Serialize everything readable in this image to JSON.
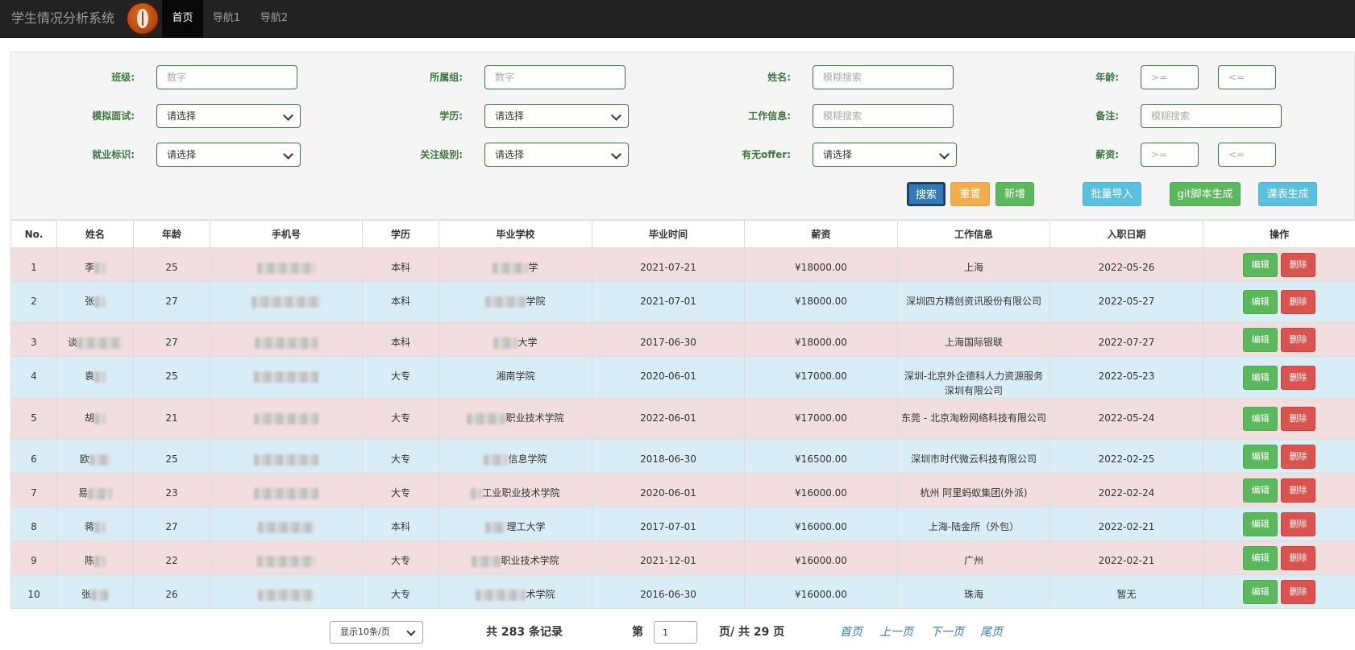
{
  "app": {
    "title": "学生情况分析系统",
    "nav": [
      "首页",
      "导航1",
      "导航2"
    ]
  },
  "filters": {
    "class_label": "班级:",
    "class_placeholder": "数字",
    "group_label": "所属组:",
    "group_placeholder": "数字",
    "name_label": "姓名:",
    "name_placeholder": "模糊搜索",
    "age_label": "年龄:",
    "age_min_placeholder": ">=",
    "age_max_placeholder": "<=",
    "mock_label": "模拟面试:",
    "mock_value": "请选择",
    "edu_label": "学历:",
    "edu_value": "请选择",
    "work_label": "工作信息:",
    "work_placeholder": "模糊搜索",
    "remark_label": "备注:",
    "remark_placeholder": "模糊搜索",
    "employ_label": "就业标识:",
    "employ_value": "请选择",
    "focus_label": "关注级别:",
    "focus_value": "请选择",
    "offer_label": "有无offer:",
    "offer_value": "请选择",
    "salary_label": "薪资:",
    "salary_min_placeholder": ">=",
    "salary_max_placeholder": "<="
  },
  "actions": {
    "search": "搜索",
    "reset": "重置",
    "add": "新增",
    "import": "批量导入",
    "git": "git脚本生成",
    "table_gen": "课表生成"
  },
  "table": {
    "headers": [
      "No.",
      "姓名",
      "年龄",
      "手机号",
      "学历",
      "毕业学校",
      "毕业时间",
      "薪资",
      "工作信息",
      "入职日期",
      "操作"
    ],
    "edit_label": "编辑",
    "delete_label": "删除",
    "rows": [
      {
        "no": "1",
        "name": "李",
        "age": "25",
        "edu": "本科",
        "school": "学",
        "grad": "2021-07-21",
        "salary": "¥18000.00",
        "work": "上海",
        "hire": "2022-05-26"
      },
      {
        "no": "2",
        "name": "张",
        "age": "27",
        "edu": "本科",
        "school": "学院",
        "grad": "2021-07-01",
        "salary": "¥18000.00",
        "work": "深圳四方精创资讯股份有限公司",
        "hire": "2022-05-27"
      },
      {
        "no": "3",
        "name": "谈",
        "age": "27",
        "edu": "本科",
        "school": "大学",
        "grad": "2017-06-30",
        "salary": "¥18000.00",
        "work": "上海国际银联",
        "hire": "2022-07-27"
      },
      {
        "no": "4",
        "name": "袁",
        "age": "25",
        "edu": "大专",
        "school": "湘南学院",
        "grad": "2020-06-01",
        "salary": "¥17000.00",
        "work": "深圳-北京外企德科人力资源服务深圳有限公司",
        "hire": "2022-05-23"
      },
      {
        "no": "5",
        "name": "胡",
        "age": "21",
        "edu": "大专",
        "school": "职业技术学院",
        "grad": "2022-06-01",
        "salary": "¥17000.00",
        "work": "东莞 - 北京淘粉网络科技有限公司",
        "hire": "2022-05-24"
      },
      {
        "no": "6",
        "name": "欧",
        "age": "25",
        "edu": "大专",
        "school": "信息学院",
        "grad": "2018-06-30",
        "salary": "¥16500.00",
        "work": "深圳市时代微云科技有限公司",
        "hire": "2022-02-25"
      },
      {
        "no": "7",
        "name": "易",
        "age": "23",
        "edu": "大专",
        "school": "工业职业技术学院",
        "grad": "2020-06-01",
        "salary": "¥16000.00",
        "work": "杭州 阿里蚂蚁集团(外派)",
        "hire": "2022-02-24"
      },
      {
        "no": "8",
        "name": "蒋",
        "age": "27",
        "edu": "本科",
        "school": "理工大学",
        "grad": "2017-07-01",
        "salary": "¥16000.00",
        "work": "上海-陆金所（外包）",
        "hire": "2022-02-21"
      },
      {
        "no": "9",
        "name": "陈",
        "age": "22",
        "edu": "大专",
        "school": "职业技术学院",
        "grad": "2021-12-01",
        "salary": "¥16000.00",
        "work": "广州",
        "hire": "2022-02-21"
      },
      {
        "no": "10",
        "name": "张",
        "age": "26",
        "edu": "大专",
        "school": "术学院",
        "grad": "2016-06-30",
        "salary": "¥16000.00",
        "work": "珠海",
        "hire": "暂无"
      }
    ]
  },
  "pager": {
    "page_size": "显示10条/页",
    "total_prefix": "共 ",
    "total": "283",
    "total_suffix": " 条记录",
    "page_prefix": "第",
    "current": "1",
    "page_mid": "页/ 共 ",
    "pages": "29",
    "page_suffix": " 页",
    "first": "首页",
    "prev": "上一页",
    "next": "下一页",
    "last": "尾页"
  }
}
